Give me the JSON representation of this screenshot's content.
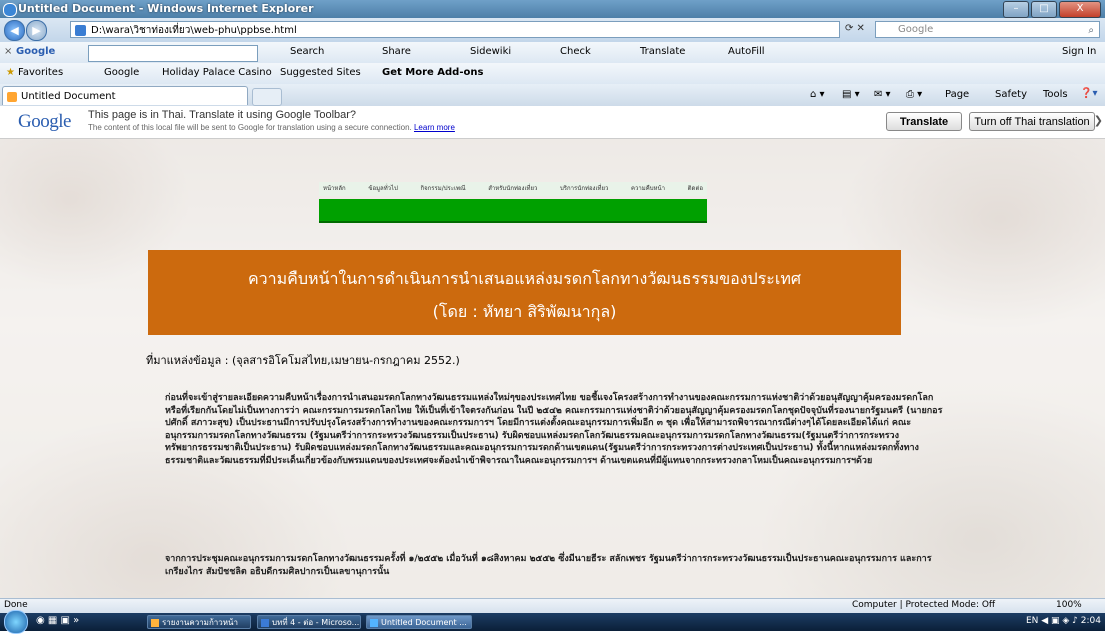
{
  "window": {
    "title": "Untitled Document - Windows Internet Explorer",
    "min": "–",
    "max": "□",
    "close": "X"
  },
  "address_bar": {
    "url": "D:\\wara\\วิชาท่องเที่ยว\\web-phu\\ppbse.html",
    "search_placeholder": "Google",
    "search_icon": "search-icon"
  },
  "google_toolbar": {
    "label": "Google",
    "items": [
      "Search",
      "Share",
      "Sidewiki",
      "Check",
      "Translate",
      "AutoFill"
    ],
    "sign_in": "Sign In"
  },
  "favorites_bar": {
    "favorites": "Favorites",
    "items": [
      "Google",
      "Holiday Palace Casino",
      "Suggested Sites",
      "Get More Add-ons"
    ]
  },
  "tab": {
    "title": "Untitled Document"
  },
  "command_bar": {
    "items": [
      "Page",
      "Safety",
      "Tools"
    ]
  },
  "translate_bar": {
    "logo": "Google",
    "message": "This page is in Thai.  Translate it using Google Toolbar?",
    "note": "The content of this local file will be sent to Google for translation using a secure connection.",
    "learn_more": "Learn more",
    "translate_btn": "Translate",
    "turn_off_btn": "Turn off Thai translation",
    "close": "X"
  },
  "page": {
    "menu": [
      "หน้าหลัก",
      "ข้อมูลทั่วไป",
      "กิจกรรม/ประเพณี",
      "สำหรับนักท่องเที่ยว",
      "บริการนักท่องเที่ยว",
      "ความคืบหน้า",
      "ติดต่อ"
    ],
    "banner_line1": "ความคืบหน้าในการดำเนินการนำเสนอแหล่งมรดกโลกทางวัฒนธรรมของประเทศ",
    "banner_line2": "(โดย : หัทยา สิริพัฒนากุล)",
    "source": "ที่มาแหล่งข้อมูล : (จุลสารอิโคโมสไทย,เมษายน-กรกฎาคม 2552.)",
    "paragraph1": "ก่อนที่จะเข้าสู่รายละเอียดความคืบหน้าเรื่องการนำเสนอมรดกโลกทางวัฒนธรรมแหล่งใหม่ๆของประเทศไทย ขอชี้แจงโครงสร้างการทำงานของคณะกรรมการแห่งชาติว่าด้วยอนุสัญญาคุ้มครองมรดกโลก หรือที่เรียกกันโดยไม่เป็นทางการว่า คณะกรรมการมรดกโลกไทย ให้เป็นที่เข้าใจตรงกันก่อน ในปี ๒๕๔๒ คณะกรรมการแห่งชาติว่าด้วยอนุสัญญาคุ้มครองมรดกโลกชุดปัจจุบันที่รองนายกรัฐมนตรี (นายกอรปศักดิ์ สภาวะสุข) เป็นประธานมีการปรับปรุงโครงสร้างการทำงานของคณะกรรมการฯ โดยมีการแต่งตั้งคณะอนุกรรมการเพิ่มอีก ๓ ชุด เพื่อให้สามารถพิจารณากรณีต่างๆได้โดยละเอียดได้แก่ คณะอนุกรรมการมรดกโลกทางวัฒนธรรม (รัฐมนตรีว่าการกระทรวงวัฒนธรรมเป็นประธาน) รับผิดชอบแหล่งมรดกโลกวัฒนธรรมคณะอนุกรรมการมรดกโลกทางวัฒนธรรม(รัฐมนตรีว่าการกระทรวงทรัพยากรธรรมชาติเป็นประธาน) รับผิดชอบแหล่งมรดกโลกทางวัฒนธรรมและคณะอนุกรรมการมรดกด้านเขตแดน(รัฐมนตรีว่าการกระทรวงการต่างประเทศเป็นประธาน) ทั้งนี้หากแหล่งมรดกทั้งทางธรรมชาติและวัฒนธรรมที่มีประเด็นเกี่ยวข้องกับพรมแดนของประเทศจะต้องนำเข้าพิจารณาในคณะอนุกรรมการฯ ด้านเขตแดนที่มีผู้แทนจากกระทรวงกลาโหมเป็นคณะอนุกรรมการฯด้วย",
    "paragraph2": "จากการประชุมคณะอนุกรรมการมรดกโลกทางวัฒนธรรมครั้งที่ ๑/๒๕๕๒ เมื่อวันที่ ๑๘สิงหาคม ๒๕๕๒ ซึ่งมีนายธีระ สลักเพชร รัฐมนตรีว่าการกระทรวงวัฒนธรรมเป็นประธานคณะอนุกรรมการ และการเกรียงไกร สัมปัชชลิต อธิบดีกรมศิลปากรเป็นเลขานุการนั้น"
  },
  "status_bar": {
    "left": "Done",
    "zone": "Computer | Protected Mode: Off",
    "zoom": "100%"
  },
  "taskbar": {
    "tasks": [
      "รายงานความก้าวหน้า",
      "บทที่ 4 - ต่อ - Microso...",
      "Untitled Document ..."
    ],
    "lang": "EN",
    "time": "2:04"
  }
}
